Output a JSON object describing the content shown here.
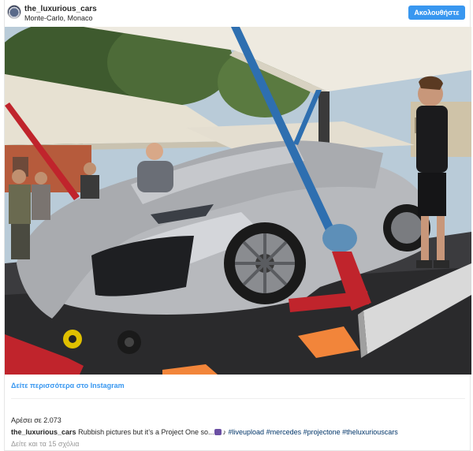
{
  "header": {
    "username": "the_luxurious_cars",
    "location": "Monte-Carlo, Monaco",
    "follow_label": "Ακολουθήστε"
  },
  "photo": {
    "subject": "car-photo"
  },
  "footer": {
    "view_more": "Δείτε περισσότερα στο Instagram",
    "likes": "Αρέσει σε 2.073",
    "caption_user": "the_luxurious_cars",
    "caption_text": "Rubbish pictures but it’s a Project One so...",
    "hashtags": [
      "#liveupload",
      "#mercedes",
      "#projectone",
      "#theluxuriouscars"
    ],
    "comments": "Δείτε και τα 15 σχόλια"
  },
  "colors": {
    "accent": "#3897f0",
    "hashtag": "#003569",
    "muted": "#999999"
  }
}
